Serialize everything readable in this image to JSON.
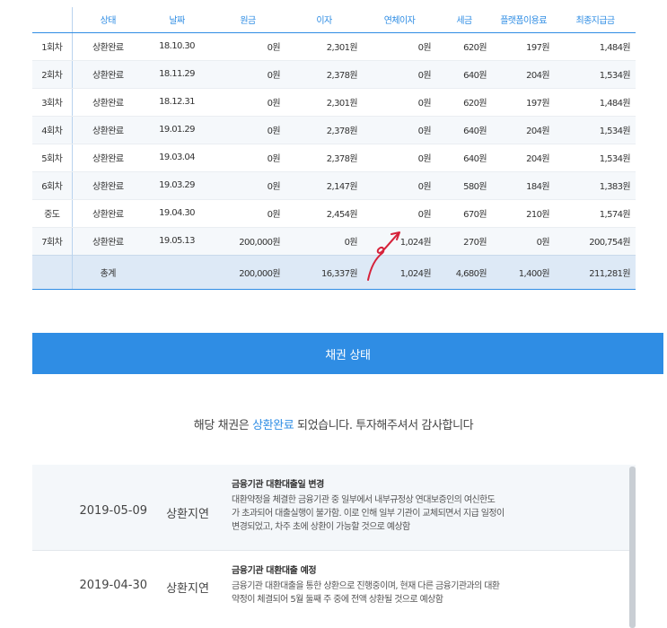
{
  "table": {
    "headers": [
      "",
      "상태",
      "날짜",
      "원금",
      "이자",
      "연체이자",
      "세금",
      "플랫폼이용료",
      "최종지급금"
    ],
    "rows": [
      [
        "1회차",
        "상환완료",
        "18.10.30",
        "0원",
        "2,301원",
        "0원",
        "620원",
        "197원",
        "1,484원"
      ],
      [
        "2회차",
        "상환완료",
        "18.11.29",
        "0원",
        "2,378원",
        "0원",
        "640원",
        "204원",
        "1,534원"
      ],
      [
        "3회차",
        "상환완료",
        "18.12.31",
        "0원",
        "2,301원",
        "0원",
        "620원",
        "197원",
        "1,484원"
      ],
      [
        "4회차",
        "상환완료",
        "19.01.29",
        "0원",
        "2,378원",
        "0원",
        "640원",
        "204원",
        "1,534원"
      ],
      [
        "5회차",
        "상환완료",
        "19.03.04",
        "0원",
        "2,378원",
        "0원",
        "640원",
        "204원",
        "1,534원"
      ],
      [
        "6회차",
        "상환완료",
        "19.03.29",
        "0원",
        "2,147원",
        "0원",
        "580원",
        "184원",
        "1,383원"
      ],
      [
        "중도",
        "상환완료",
        "19.04.30",
        "0원",
        "2,454원",
        "0원",
        "670원",
        "210원",
        "1,574원"
      ],
      [
        "7회차",
        "상환완료",
        "19.05.13",
        "200,000원",
        "0원",
        "1,024원",
        "270원",
        "0원",
        "200,754원"
      ]
    ],
    "total": {
      "label": "총계",
      "principal": "200,000원",
      "interest": "16,337원",
      "late_interest": "1,024원",
      "tax": "4,680원",
      "fee": "1,400원",
      "final": "211,281원"
    }
  },
  "bond_status": {
    "bar_label": "채권 상태",
    "message_prefix": "해당 채권은 ",
    "message_highlight": "상환완료",
    "message_suffix": " 되었습니다. 투자해주셔서 감사합니다"
  },
  "history": [
    {
      "date": "2019-05-09",
      "state": "상환지연",
      "title": "금융기관 대환대출일 변경",
      "lines": [
        "대환약정을 체결한 금융기관 중 일부에서 내부규정상 연대보증인의 여신한도",
        "가 초과되어 대출실행이 불가함. 이로 인해 일부 기관이 교체되면서 지급 일정이",
        "변경되었고, 차주 초에 상환이 가능할 것으로 예상함"
      ]
    },
    {
      "date": "2019-04-30",
      "state": "상환지연",
      "title": "금융기관 대환대출 예정",
      "lines": [
        "금융기관 대환대출을 통한 상환으로 진행중이며, 현재 다른 금융기관과의 대환",
        "약정이 체결되어 5월 둘째 주 중에 전액 상환될 것으로 예상함"
      ]
    }
  ],
  "colors": {
    "accent": "#2f8de4",
    "annotation": "#d6223a"
  }
}
